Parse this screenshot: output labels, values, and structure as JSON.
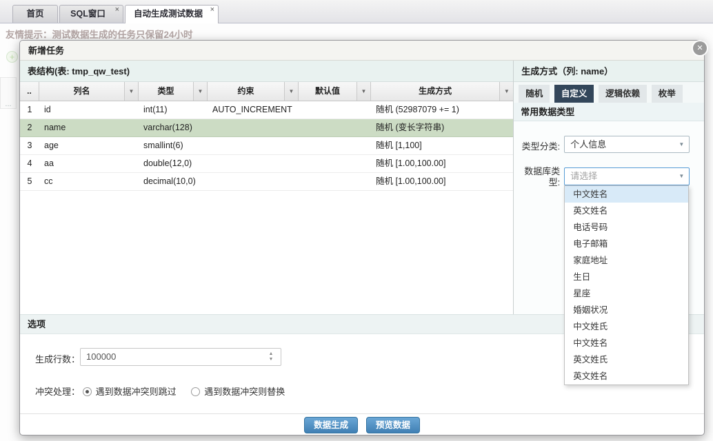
{
  "tab_bar": {
    "tabs": [
      {
        "label": "首页",
        "active": false,
        "closable": false
      },
      {
        "label": "SQL窗口",
        "active": false,
        "closable": true
      },
      {
        "label": "自动生成测试数据",
        "active": true,
        "closable": true
      }
    ]
  },
  "glyphs": {
    "tab_close": "×",
    "modal_close": "✕",
    "filter_chevron": "▼",
    "select_chevron": "▼",
    "spin_up": "▲",
    "spin_down": "▼",
    "plus": "+",
    "dots": "..."
  },
  "background": {
    "hint": "友情提示：测试数据生成的任务只保留24小时"
  },
  "modal": {
    "title": "新增任务",
    "table_panel": {
      "header": "表结构(表: tmp_qw_test)",
      "columns": [
        "..",
        "列名",
        "类型",
        "约束",
        "默认值",
        "生成方式"
      ],
      "rows": [
        {
          "idx": "1",
          "name": "id",
          "type": "int(11)",
          "constraint": "AUTO_INCREMENT",
          "default": "",
          "gen": "随机 (52987079 += 1)",
          "selected": false
        },
        {
          "idx": "2",
          "name": "name",
          "type": "varchar(128)",
          "constraint": "",
          "default": "",
          "gen": "随机 (变长字符串)",
          "selected": true
        },
        {
          "idx": "3",
          "name": "age",
          "type": "smallint(6)",
          "constraint": "",
          "default": "",
          "gen": "随机 [1,100]",
          "selected": false
        },
        {
          "idx": "4",
          "name": "aa",
          "type": "double(12,0)",
          "constraint": "",
          "default": "",
          "gen": "随机 [1.00,100.00]",
          "selected": false
        },
        {
          "idx": "5",
          "name": "cc",
          "type": "decimal(10,0)",
          "constraint": "",
          "default": "",
          "gen": "随机 [1.00,100.00]",
          "selected": false
        }
      ]
    },
    "gen_panel": {
      "header": "生成方式（列: name）",
      "tabs": [
        "随机",
        "自定义",
        "逻辑依赖",
        "枚举"
      ],
      "active_tab": "自定义",
      "section_header": "常用数据类型",
      "type_category": {
        "label": "类型分类:",
        "value": "个人信息"
      },
      "db_type": {
        "label_line1": "数据库类",
        "label_line2": "型:",
        "placeholder": "请选择"
      },
      "dropdown_options": [
        "中文姓名",
        "英文姓名",
        "电话号码",
        "电子邮箱",
        "家庭地址",
        "生日",
        "星座",
        "婚姻状况",
        "中文姓氏",
        "中文姓名",
        "英文姓氏",
        "英文姓名"
      ],
      "highlighted_option": "中文姓名"
    },
    "options_panel": {
      "header": "选项",
      "row_count_label": "生成行数：",
      "row_count_value": "100000",
      "conflict_label": "冲突处理：",
      "conflict_options": [
        {
          "label": "遇到数据冲突则跳过",
          "selected": true
        },
        {
          "label": "遇到数据冲突则替换",
          "selected": false
        }
      ]
    },
    "footer": {
      "generate_label": "数据生成",
      "preview_label": "预览数据"
    }
  },
  "colors": {
    "accent_button": "#4080b4",
    "active_gen_tab": "#33465a",
    "selected_row": "#ccdcc4",
    "dropdown_highlight": "#d8eaf8",
    "panel_header_bg": "#e9f2f0",
    "open_select_border": "#569bd5"
  }
}
